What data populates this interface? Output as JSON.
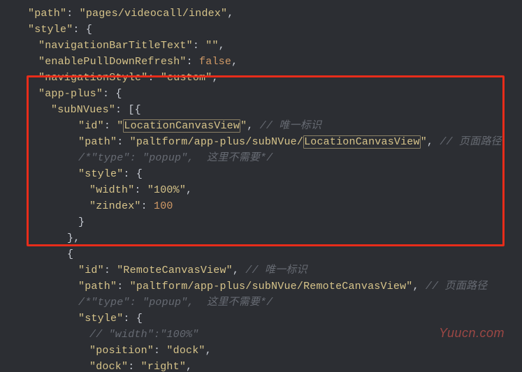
{
  "code": {
    "path_key": "\"path\"",
    "path_val": "\"pages/videocall/index\"",
    "style_key": "\"style\"",
    "nav_title_key": "\"navigationBarTitleText\"",
    "nav_title_val": "\"\"",
    "pulldown_key": "\"enablePullDownRefresh\"",
    "pulldown_val": "false",
    "nav_style_key": "\"navigationStyle\"",
    "nav_style_val": "\"custom\"",
    "app_plus_key": "\"app-plus\"",
    "subnvues_key": "\"subNVues\"",
    "id_key": "\"id\"",
    "id1_quote_open": "\"",
    "id1_val_hl": "LocationCanvasView",
    "id1_quote_close": "\"",
    "comm_id": "// 唯一标识",
    "path_nvue_key": "\"path\"",
    "path_nvue_val_pre": "\"paltform/app-plus/subNVue/",
    "path_nvue_val_hl": "LocationCanvasView",
    "path_nvue_val_post": "\"",
    "comm_path": "// 页面路径",
    "comm_type": "/*\"type\": \"popup\",  这里不需要*/",
    "style_nvue_key": "\"style\"",
    "width_key": "\"width\"",
    "width_val": "\"100%\"",
    "zindex_key": "\"zindex\"",
    "zindex_val": "100",
    "id2_val": "\"RemoteCanvasView\"",
    "path2_val": "\"paltform/app-plus/subNVue/RemoteCanvasView\"",
    "comm_width": "// \"width\":\"100%\"",
    "position_key": "\"position\"",
    "position_val": "\"dock\"",
    "dock_key": "\"dock\"",
    "dock_val": "\"right\""
  },
  "watermark": "Yuucn.com"
}
